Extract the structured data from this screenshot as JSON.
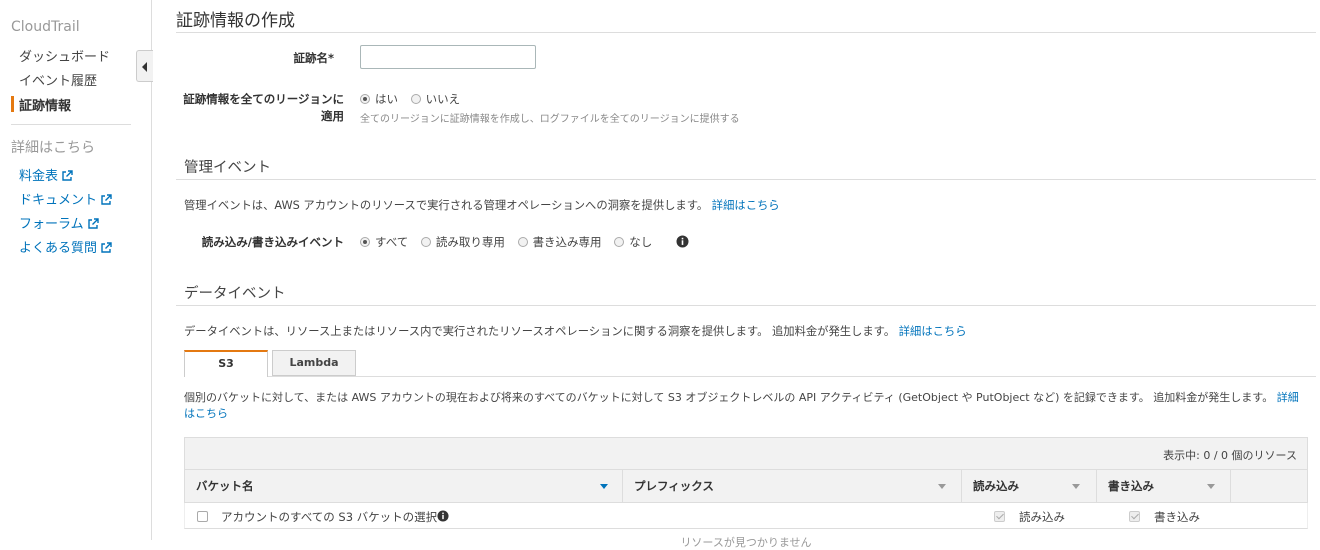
{
  "sidebar": {
    "brand": "CloudTrail",
    "items": [
      {
        "label": "ダッシュボード"
      },
      {
        "label": "イベント履歴"
      },
      {
        "label": "証跡情報"
      }
    ],
    "more_heading": "詳細はこちら",
    "links": [
      {
        "label": "料金表"
      },
      {
        "label": "ドキュメント"
      },
      {
        "label": "フォーラム"
      },
      {
        "label": "よくある質問"
      }
    ]
  },
  "page": {
    "title": "証跡情報の作成"
  },
  "trail_name": {
    "label": "証跡名*",
    "value": ""
  },
  "all_regions": {
    "label_line1": "証跡情報を全てのリージョンに",
    "label_line2": "適用",
    "options": [
      "はい",
      "いいえ"
    ],
    "selected": "はい",
    "help": "全てのリージョンに証跡情報を作成し、ログファイルを全てのリージョンに提供する"
  },
  "management_events": {
    "title": "管理イベント",
    "description": "管理イベントは、AWS アカウントのリソースで実行される管理オペレーションへの洞察を提供します。",
    "learn_more": "詳細はこちら",
    "rw_label": "読み込み/書き込みイベント",
    "rw_options": [
      "すべて",
      "読み取り専用",
      "書き込み専用",
      "なし"
    ],
    "rw_selected": "すべて"
  },
  "data_events": {
    "title": "データイベント",
    "description": "データイベントは、リソース上またはリソース内で実行されたリソースオペレーションに関する洞察を提供します。 追加料金が発生します。",
    "learn_more": "詳細はこちら",
    "tabs": [
      "S3",
      "Lambda"
    ],
    "active_tab": "S3",
    "s3_description": "個別のバケットに対して、または AWS アカウントの現在および将来のすべてのバケットに対して S3 オブジェクトレベルの API アクティビティ (GetObject や PutObject など) を記録できます。 追加料金が発生します。",
    "s3_learn_more_1": "詳細",
    "s3_learn_more_2": "はこちら",
    "table": {
      "count_text": "表示中: 0 / 0 個のリソース",
      "columns": [
        "バケット名",
        "プレフィックス",
        "読み込み",
        "書き込み"
      ],
      "all_buckets_row": {
        "label": "アカウントのすべての S3 バケットの選択",
        "read_label": "読み込み",
        "write_label": "書き込み"
      },
      "empty_message": "リソースが見つかりません"
    }
  },
  "colors": {
    "accent_orange": "#e47911",
    "link_blue": "#0073bb"
  }
}
